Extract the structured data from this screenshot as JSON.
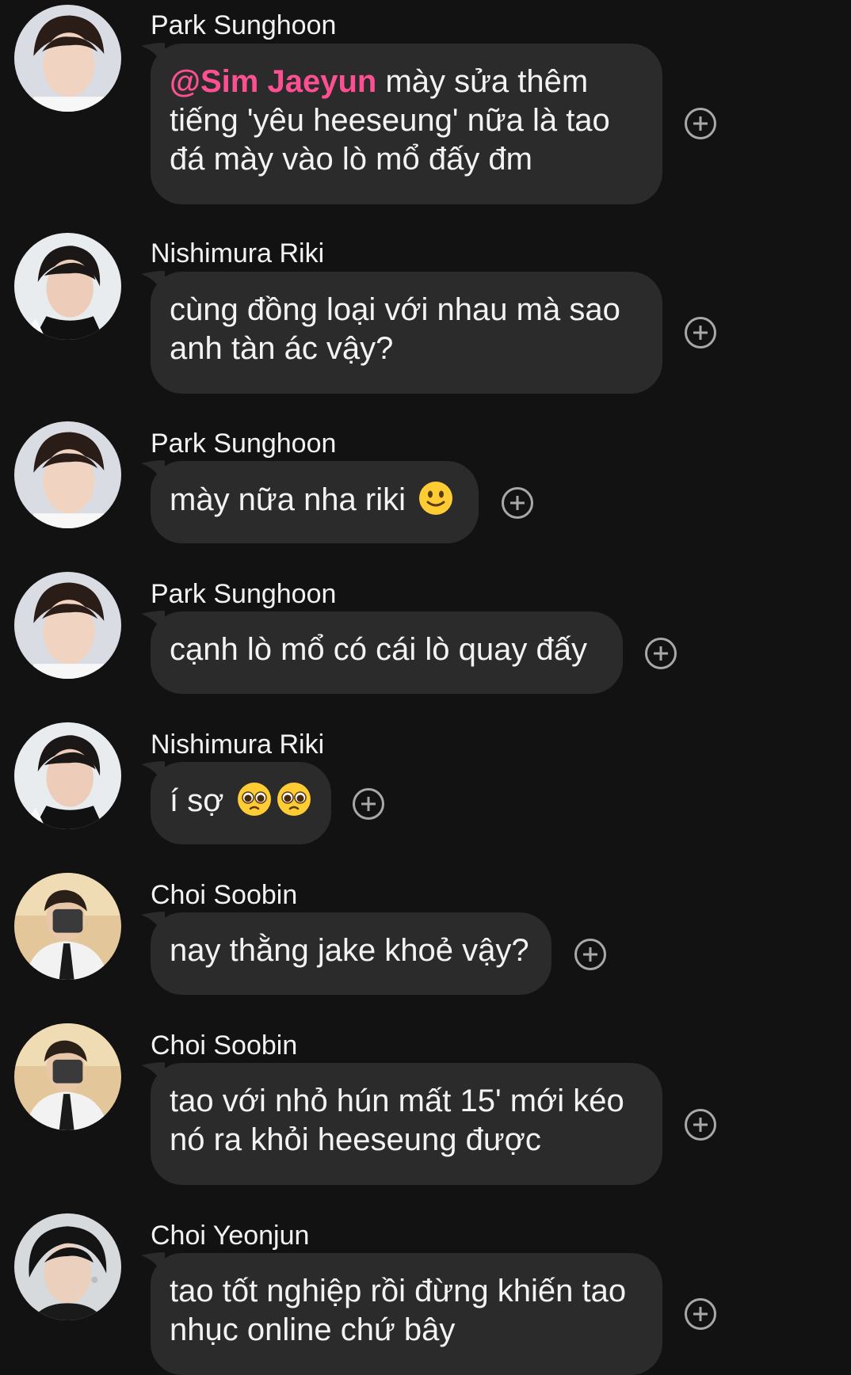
{
  "messages": [
    {
      "sender": "Park Sunghoon",
      "mention": "@Sim Jaeyun",
      "text": " mày sửa thêm tiếng 'yêu heeseung' nữa là tao đá mày vào lò mổ đấy đm",
      "avatar": "avatar-sunghoon"
    },
    {
      "sender": "Nishimura Riki",
      "text": "cùng đồng loại với nhau mà sao anh tàn ác vậy?",
      "avatar": "avatar-riki"
    },
    {
      "sender": "Park Sunghoon",
      "text": "mày nữa nha riki",
      "emoji": [
        "slightly-smiling-face-emoji"
      ],
      "avatar": "avatar-sunghoon"
    },
    {
      "sender": "Park Sunghoon",
      "text": "cạnh lò mổ có cái lò quay đấy",
      "avatar": "avatar-sunghoon"
    },
    {
      "sender": "Nishimura Riki",
      "text": "í sợ",
      "emoji": [
        "pleading-face-emoji",
        "pleading-face-emoji"
      ],
      "avatar": "avatar-riki"
    },
    {
      "sender": "Choi Soobin",
      "text": "nay thằng jake khoẻ vậy?",
      "avatar": "avatar-soobin"
    },
    {
      "sender": "Choi Soobin",
      "text": "tao với nhỏ hún mất 15' mới kéo nó ra khỏi heeseung được",
      "avatar": "avatar-soobin"
    },
    {
      "sender": "Choi Yeonjun",
      "text": "tao tốt nghiệp rồi đừng khiến tao nhục online chứ bây",
      "avatar": "avatar-yeonjun"
    }
  ],
  "icons": {
    "react": "add-reaction-icon"
  },
  "colors": {
    "background": "#121212",
    "bubble": "#2b2b2b",
    "mention": "#ff4f93",
    "icon": "#a8a8a8"
  }
}
